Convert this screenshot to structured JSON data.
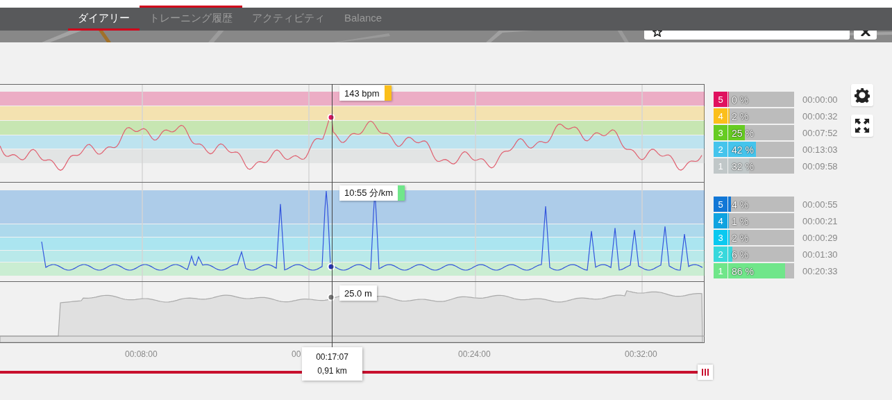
{
  "nav": {
    "tabs": [
      {
        "label": "ダイアリー",
        "selected": true,
        "hovered": false
      },
      {
        "label": "トレーニング履歴",
        "selected": false,
        "hovered": true
      },
      {
        "label": "アクティビティ",
        "selected": false,
        "hovered": false
      },
      {
        "label": "Balance",
        "selected": false,
        "hovered": false
      }
    ]
  },
  "heart_rate": {
    "readout": {
      "text": "143 bpm",
      "color": "#fbbf1b"
    },
    "zones": [
      {
        "zone": "5",
        "percent": "0 %",
        "time": "00:00:00",
        "level": 0,
        "color": "#e0115f"
      },
      {
        "zone": "4",
        "percent": "2 %",
        "time": "00:00:32",
        "level": 0.02,
        "color": "#fbbf1b"
      },
      {
        "zone": "3",
        "percent": "25 %",
        "time": "00:07:52",
        "level": 0.25,
        "color": "#66cc22"
      },
      {
        "zone": "2",
        "percent": "42 %",
        "time": "00:13:03",
        "level": 0.42,
        "color": "#45c4ec"
      },
      {
        "zone": "1",
        "percent": "32 %",
        "time": "00:09:58",
        "level": 0.32,
        "color": "#c0c7c8"
      }
    ]
  },
  "pace": {
    "readout": {
      "text": "10:55 分/km",
      "color": "#70e68a"
    },
    "zones": [
      {
        "zone": "5",
        "percent": "4 %",
        "time": "00:00:55",
        "level": 0.04,
        "color": "#1177d6"
      },
      {
        "zone": "4",
        "percent": "1 %",
        "time": "00:00:21",
        "level": 0.01,
        "color": "#0fa3e0"
      },
      {
        "zone": "3",
        "percent": "2 %",
        "time": "00:00:29",
        "level": 0.02,
        "color": "#0ac9f0"
      },
      {
        "zone": "2",
        "percent": "6 %",
        "time": "00:01:30",
        "level": 0.06,
        "color": "#38d8dc"
      },
      {
        "zone": "1",
        "percent": "86 %",
        "time": "00:20:33",
        "level": 0.86,
        "color": "#70e68a"
      }
    ]
  },
  "altitude": {
    "readout": "25.0 m"
  },
  "x_axis": {
    "ticks": [
      "00:08:00",
      "00",
      "00:24:00",
      "00:32:00"
    ]
  },
  "cursor": {
    "time": "00:17:07",
    "distance": "0,91 km"
  }
}
